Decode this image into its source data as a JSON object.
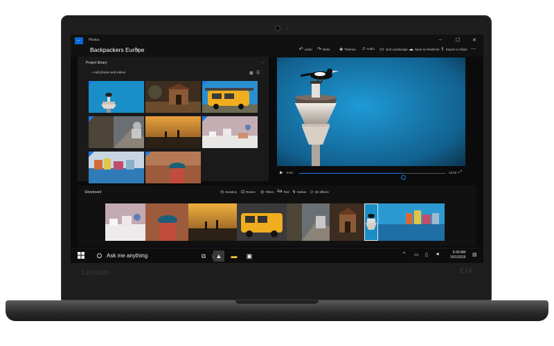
{
  "device": {
    "brand": "Lenovo",
    "model": "E14"
  },
  "window": {
    "app_name": "Photos",
    "project_title": "Backpackers Europe",
    "controls": {
      "minimize": "–",
      "maximize": "☐",
      "close": "✕"
    },
    "toolbar": [
      {
        "icon": "undo-icon",
        "glyph": "↶",
        "label": "Undo"
      },
      {
        "icon": "redo-icon",
        "glyph": "↷",
        "label": "Redo"
      },
      {
        "icon": "themes-icon",
        "glyph": "◈",
        "label": "Themes"
      },
      {
        "icon": "audio-icon",
        "glyph": "♫",
        "label": "Audio"
      },
      {
        "icon": "aspect-ratio-icon",
        "glyph": "▭",
        "label": "16:9 Landscape"
      },
      {
        "icon": "cloud-icon",
        "glyph": "☁",
        "label": "Save to OneDrive"
      },
      {
        "icon": "export-icon",
        "glyph": "⇪",
        "label": "Export or share"
      },
      {
        "icon": "more-icon",
        "glyph": "⋯",
        "label": ""
      }
    ]
  },
  "library": {
    "title": "Project library",
    "add_label": "+   Add photos and videos",
    "collapse": "‹",
    "view_icons": [
      "▦",
      "☰"
    ]
  },
  "preview": {
    "play": "▶",
    "current_time": "0:23",
    "total_time": "12:23",
    "progress": 0.71,
    "fullscreen": "⤢"
  },
  "storyboard": {
    "title": "Storyboard",
    "tools": [
      {
        "icon": "duration-icon",
        "glyph": "◷",
        "label": "Duration"
      },
      {
        "icon": "resize-icon",
        "glyph": "⊡",
        "label": "Resize"
      },
      {
        "icon": "filters-icon",
        "glyph": "◎",
        "label": "Filters"
      },
      {
        "icon": "text-icon",
        "glyph": "Aa",
        "label": "Text"
      },
      {
        "icon": "motion-icon",
        "glyph": "↯",
        "label": "Motion"
      },
      {
        "icon": "3d-effects-icon",
        "glyph": "◇",
        "label": "3D effects"
      }
    ]
  },
  "taskbar": {
    "search_placeholder": "Ask me anything",
    "apps": [
      {
        "icon": "task-view-icon",
        "glyph": "⧉"
      },
      {
        "icon": "photos-app-icon",
        "glyph": "▲"
      },
      {
        "icon": "file-explorer-icon",
        "glyph": "▬"
      },
      {
        "icon": "store-icon",
        "glyph": "▣"
      }
    ],
    "tray": [
      {
        "icon": "chevron-up-icon",
        "glyph": "^"
      },
      {
        "icon": "battery-icon",
        "glyph": "▭"
      },
      {
        "icon": "network-icon",
        "glyph": "▯"
      },
      {
        "icon": "volume-icon",
        "glyph": "◄"
      }
    ],
    "time": "6:30 AM",
    "date": "1/01/2019",
    "notifications": "▤"
  }
}
